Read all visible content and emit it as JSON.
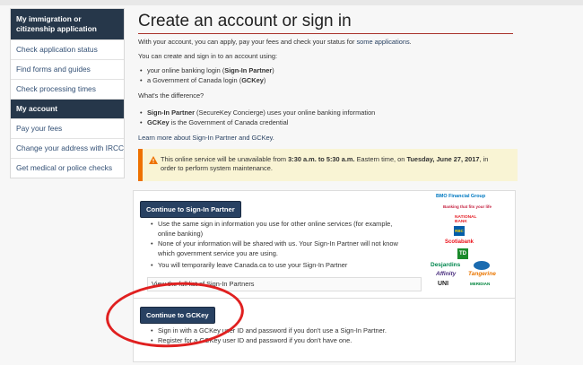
{
  "sidebar": {
    "items": [
      {
        "label": "My immigration or citizenship application"
      },
      {
        "label": "Check application status"
      },
      {
        "label": "Find forms and guides"
      },
      {
        "label": "Check processing times"
      },
      {
        "label": "My account"
      },
      {
        "label": "Pay your fees"
      },
      {
        "label": "Change your address with IRCC"
      },
      {
        "label": "Get medical or police checks"
      }
    ]
  },
  "main": {
    "title": "Create an account or sign in",
    "intro_prefix": "With your account, you can apply, pay your fees and check your status for",
    "intro_link": "some applications",
    "intro_suffix": ".",
    "using_text": "You can create and sign in to an account using:",
    "option1_prefix": "your online banking login (",
    "option1_bold": "Sign-In Partner",
    "option1_suffix": ")",
    "option2_prefix": "a Government of Canada login (",
    "option2_bold": "GCKey",
    "option2_suffix": ")",
    "difference_q": "What's the difference?",
    "diff1_bold": "Sign-In Partner",
    "diff1_rest": "(SecureKey Concierge) uses your online banking information",
    "diff2_bold": "GCKey",
    "diff2_rest": "is the Government of Canada credential",
    "learn_more": "Learn more about Sign-In Partner and GCKey.",
    "warning": {
      "t1": "This online service will be unavailable from",
      "b1": "3:30 a.m. to 5:30 a.m.",
      "t2": "Eastern time, on",
      "b2": "Tuesday, June 27, 2017",
      "t3": ", in",
      "line2": "order to perform system maintenance."
    },
    "signin_partner": {
      "button": "Continue to Sign-In Partner",
      "bullet1a": "Use the same sign in information you use for other online services (for example,",
      "bullet1b": "online banking)",
      "bullet2a": "None of your information will be shared with us. Your Sign-In Partner will not know",
      "bullet2b": "which government service you are using.",
      "bullet3": "You will temporarily leave Canada.ca to use your Sign-In Partner",
      "full_list": "View the full list of Sign-In Partners"
    },
    "gckey": {
      "button": "Continue to GCKey",
      "bullet1": "Sign in with a GCKey user ID and password if you don't use a Sign-In Partner.",
      "bullet2": "Register for a GCKey user ID and password if you don't have one."
    },
    "bank_logos": {
      "bmo": "BMO Financial Group",
      "cibc": "Banking that fits your life",
      "national": "NATIONAL BANK",
      "rbc": "RBC",
      "scotia": "Scotiabank",
      "td": "TD",
      "desjardins": "Desjardins",
      "affinity": "Affinity",
      "tangerine": "Tangerine",
      "uni": "UNI",
      "meridian": "MERIDIAN"
    }
  },
  "colors": {
    "nav_dark": "#26374a",
    "link": "#284162",
    "accent_rule": "#a8312a",
    "warning_bg": "#f9f4d4",
    "warning_border": "#ee7100",
    "annotation_circle": "#e02020"
  }
}
